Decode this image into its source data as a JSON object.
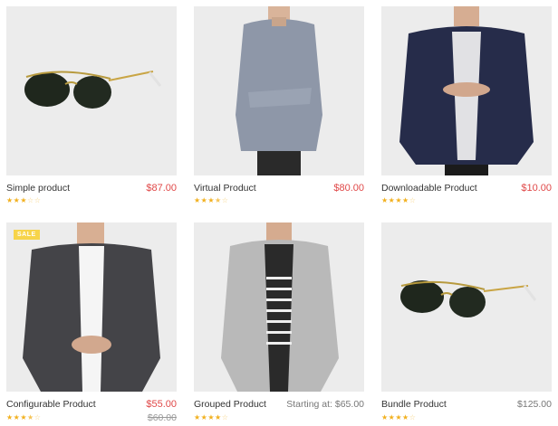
{
  "products": [
    {
      "name": "Simple product",
      "price": "$87.00",
      "old_price": "",
      "rating": 3,
      "image": "sunglasses",
      "badge": ""
    },
    {
      "name": "Virtual Product",
      "price": "$80.00",
      "old_price": "",
      "rating": 3.5,
      "image": "denim-shirt",
      "badge": ""
    },
    {
      "name": "Downloadable Product",
      "price": "$10.00",
      "old_price": "",
      "rating": 4,
      "image": "navy-blazer",
      "badge": ""
    },
    {
      "name": "Configurable Product",
      "price": "$55.00",
      "old_price": "$60.00",
      "rating": 3.5,
      "image": "grey-blazer",
      "badge": "SALE"
    },
    {
      "name": "Grouped Product",
      "price": "Starting at: $65.00",
      "old_price": "",
      "rating": 4,
      "image": "light-blazer",
      "badge": ""
    },
    {
      "name": "Bundle Product",
      "price": "$125.00",
      "old_price": "",
      "rating": 4,
      "image": "sunglasses",
      "badge": ""
    }
  ],
  "colors": {
    "price": "#e04848",
    "star": "#f2b01e",
    "badge": "#f7d44a"
  }
}
